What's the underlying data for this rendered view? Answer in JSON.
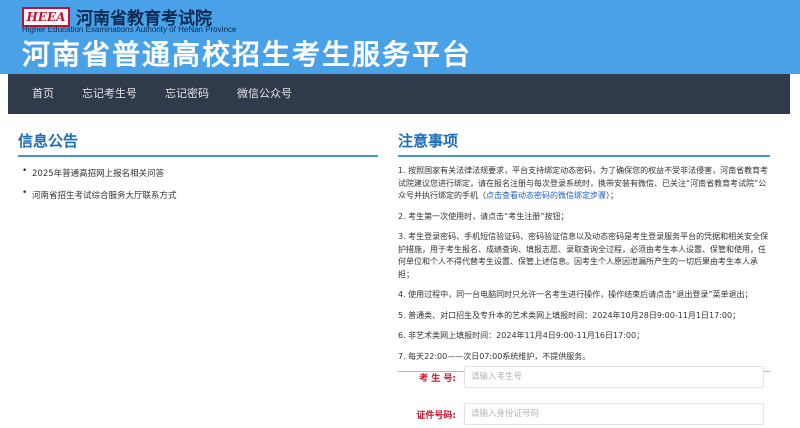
{
  "header": {
    "logo_text": "HEEA",
    "org_name": "河南省教育考试院",
    "org_name_en": "Higher Education Examinations Authority of HeNan Province",
    "site_title": "河南省普通高校招生考生服务平台"
  },
  "nav": {
    "items": [
      "首页",
      "忘记考生号",
      "忘记密码",
      "微信公众号"
    ]
  },
  "announcements": {
    "title": "信息公告",
    "items": [
      "2025年普通高招网上报名相关问答",
      "河南省招生考试综合服务大厅联系方式"
    ]
  },
  "notes": {
    "title": "注意事项",
    "items": [
      {
        "text": "1. 按照国家有关法律法规要求，平台支持绑定动态密码，为了确保您的权益不受非法侵害，河南省教育考试院建议您进行绑定，请在报名注册与每次登录系统时，携带安装有微信、已关注“河南省教育考试院”公众号并执行绑定的手机（",
        "link": "点击查看动态密码的微信绑定步骤",
        "suffix": "）；"
      },
      {
        "text": "2. 考生第一次使用时，请点击“考生注册”按钮；"
      },
      {
        "text": "3. 考生登录密码、手机短信验证码、密码验证信息以及动态密码是考生登录服务平台的凭据和相关安全保护措施，用于考生报名、成绩查询、填报志愿、录取查询全过程，必须由考生本人设置、保管和使用，任何单位和个人不得代替考生设置、保管上述信息。因考生个人原因泄漏所产生的一切后果由考生本人承担；"
      },
      {
        "text": "4. 使用过程中，同一台电脑同时只允许一名考生进行操作，操作结束后请点击“退出登录”菜单退出；"
      },
      {
        "text": "5. 普通类、对口招生及专升本的艺术类网上填报时间：2024年10月28日9:00-11月1日17:00；"
      },
      {
        "text": "6. 非艺术类网上填报时间：2024年11月4日9:00-11月16日17:00；"
      },
      {
        "text": "7. 每天22:00——次日07:00系统维护，不提供服务。"
      }
    ]
  },
  "login": {
    "candidate_label": "考 生 号:",
    "candidate_placeholder": "请输入考生号",
    "id_label": "证件号码:",
    "id_placeholder": "请输入身份证号码"
  },
  "colors": {
    "header_bg": "#49a2e8",
    "nav_bg": "#2f3a4a",
    "title_blue": "#1f6cb8",
    "label_red": "#c8102e"
  }
}
